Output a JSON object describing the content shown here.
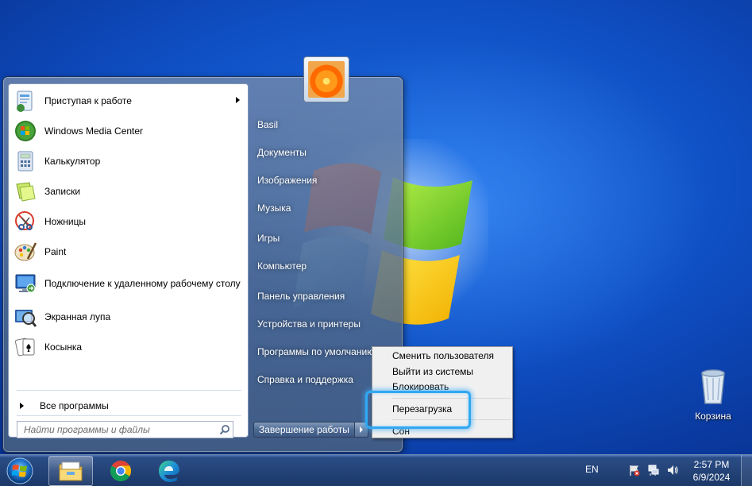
{
  "start_menu": {
    "programs": [
      {
        "label": "Приступая к работе",
        "icon": "getting-started-icon",
        "has_submenu": true
      },
      {
        "label": "Windows Media Center",
        "icon": "media-center-icon"
      },
      {
        "label": "Калькулятор",
        "icon": "calculator-icon"
      },
      {
        "label": "Записки",
        "icon": "sticky-notes-icon"
      },
      {
        "label": "Ножницы",
        "icon": "snipping-tool-icon"
      },
      {
        "label": "Paint",
        "icon": "paint-icon"
      },
      {
        "label": "Подключение к удаленному рабочему столу",
        "icon": "remote-desktop-icon"
      },
      {
        "label": "Экранная лупа",
        "icon": "magnifier-icon"
      },
      {
        "label": "Косынка",
        "icon": "solitaire-icon"
      }
    ],
    "all_programs": "Все программы",
    "search_placeholder": "Найти программы и файлы",
    "right_items": [
      "Basil",
      "Документы",
      "Изображения",
      "Музыка",
      "Игры",
      "Компьютер",
      "Панель управления",
      "Устройства и принтеры",
      "Программы по умолчанию",
      "Справка и поддержка"
    ],
    "shutdown_label": "Завершение работы"
  },
  "shutdown_menu": {
    "items": [
      "Сменить пользователя",
      "Выйти из системы",
      "Блокировать",
      "Перезагрузка",
      "Сон"
    ],
    "highlighted": "Перезагрузка"
  },
  "desktop": {
    "recycle_bin": "Корзина"
  },
  "taskbar": {
    "apps": [
      "file-explorer-icon",
      "chrome-icon",
      "edge-icon"
    ],
    "language": "EN",
    "time": "2:57 PM",
    "date": "6/9/2024"
  },
  "colors": {
    "wallpaper": "#0f4fc4",
    "highlight_ring": "#31a8f2"
  }
}
